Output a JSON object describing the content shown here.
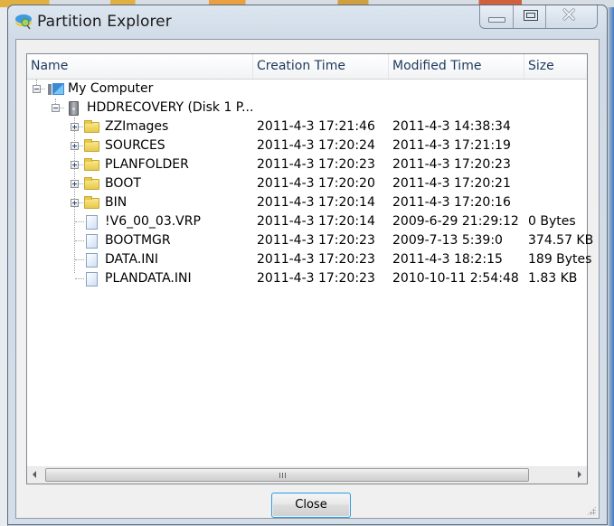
{
  "window": {
    "title": "Partition Explorer",
    "controls": {
      "minimize": "minimize",
      "maximize": "maximize",
      "close": "close"
    }
  },
  "columns": {
    "name": "Name",
    "creation_time": "Creation Time",
    "modified_time": "Modified Time",
    "size": "Size"
  },
  "tree": {
    "root": {
      "label": "My Computer",
      "icon": "computer-icon",
      "expanded": true
    },
    "disk": {
      "label": "HDDRECOVERY (Disk 1 P...",
      "icon": "hard-disk-icon",
      "expanded": true
    },
    "items": [
      {
        "type": "folder",
        "name": "ZZImages",
        "creation_time": "2011-4-3 17:21:46",
        "modified_time": "2011-4-3 14:38:34",
        "size": ""
      },
      {
        "type": "folder",
        "name": "SOURCES",
        "creation_time": "2011-4-3 17:20:24",
        "modified_time": "2011-4-3 17:21:19",
        "size": ""
      },
      {
        "type": "folder",
        "name": "PLANFOLDER",
        "creation_time": "2011-4-3 17:20:23",
        "modified_time": "2011-4-3 17:20:23",
        "size": ""
      },
      {
        "type": "folder",
        "name": "BOOT",
        "creation_time": "2011-4-3 17:20:20",
        "modified_time": "2011-4-3 17:20:21",
        "size": ""
      },
      {
        "type": "folder",
        "name": "BIN",
        "creation_time": "2011-4-3 17:20:14",
        "modified_time": "2011-4-3 17:20:16",
        "size": ""
      },
      {
        "type": "file",
        "name": "!V6_00_03.VRP",
        "creation_time": "2011-4-3 17:20:14",
        "modified_time": "2009-6-29 21:29:12",
        "size": "0 Bytes"
      },
      {
        "type": "file",
        "name": "BOOTMGR",
        "creation_time": "2011-4-3 17:20:23",
        "modified_time": "2009-7-13 5:39:0",
        "size": "374.57 KB"
      },
      {
        "type": "file",
        "name": "DATA.INI",
        "creation_time": "2011-4-3 17:20:23",
        "modified_time": "2011-4-3 18:2:15",
        "size": "189 Bytes"
      },
      {
        "type": "file",
        "name": "PLANDATA.INI",
        "creation_time": "2011-4-3 17:20:23",
        "modified_time": "2010-10-11 2:54:48",
        "size": "1.83 KB"
      }
    ]
  },
  "footer": {
    "close_label": "Close"
  }
}
